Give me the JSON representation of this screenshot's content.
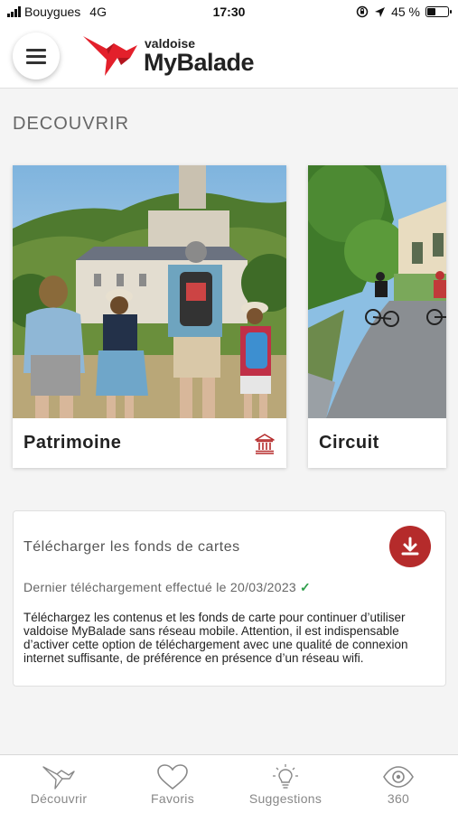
{
  "status_bar": {
    "carrier": "Bouygues",
    "network": "4G",
    "time": "17:30",
    "battery": "45 %",
    "battery_level": 0.45,
    "icons": [
      "signal-bars-icon",
      "screen-rotation-lock-icon",
      "location-arrow-icon",
      "battery-icon"
    ]
  },
  "header": {
    "logo_small": "valdoise",
    "logo_big": "MyBalade",
    "menu_icon": "hamburger-icon",
    "brand_color": "#e3202b"
  },
  "section": {
    "title": "DECOUVRIR"
  },
  "cards": [
    {
      "label": "Patrimoine",
      "icon": "monument-icon",
      "icon_color": "#b52b2b"
    },
    {
      "label": "Circuit"
    }
  ],
  "download": {
    "title": "Télécharger les fonds de cartes",
    "last_download": "Dernier téléchargement effectué le 20/03/2023",
    "check": "✓",
    "description": "Téléchargez les contenus et les fonds de carte pour continuer d’utiliser valdoise MyBalade sans réseau mobile. Attention, il est indispensable d’activer cette option de téléchargement avec une qualité de connexion internet suffisante, de préférence en présence d’un réseau wifi.",
    "button_icon": "download-icon",
    "button_color": "#b52b2b",
    "check_color": "#2e9e4a"
  },
  "nav": {
    "tabs": [
      {
        "label": "Découvrir",
        "icon": "bird-icon"
      },
      {
        "label": "Favoris",
        "icon": "heart-icon"
      },
      {
        "label": "Suggestions",
        "icon": "lightbulb-icon"
      },
      {
        "label": "360",
        "icon": "eye-icon"
      }
    ]
  }
}
